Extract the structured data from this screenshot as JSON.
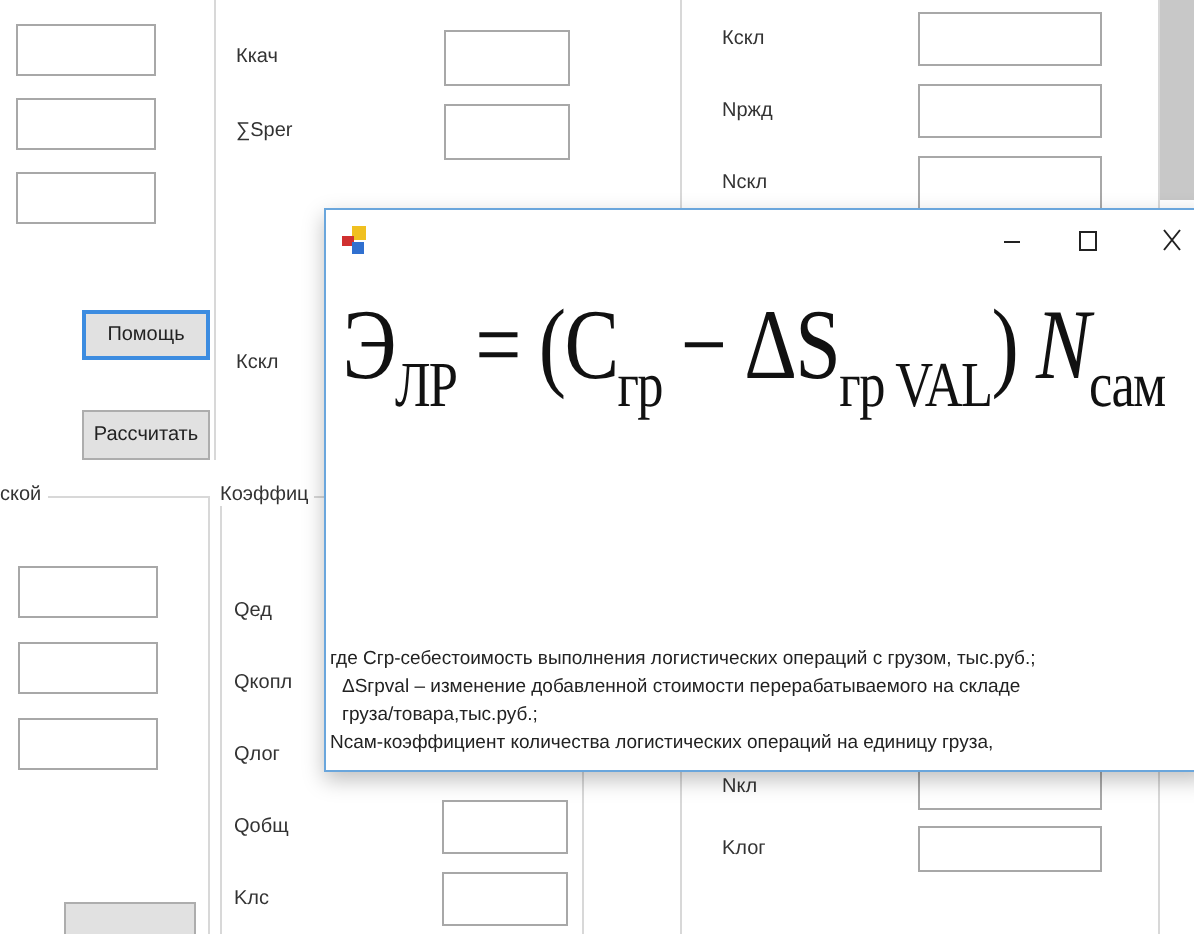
{
  "left_panel": {
    "buttons": [
      {
        "label": "Помощь",
        "selected": true
      },
      {
        "label": "Рассчитать",
        "selected": false
      }
    ]
  },
  "left_group": {
    "legend": "ской"
  },
  "middle_panel": {
    "rows": [
      {
        "label": "Ккач",
        "kind": "field"
      },
      {
        "label": "∑Sper",
        "kind": "field"
      },
      {
        "label": "Кскл",
        "kind": "label"
      }
    ]
  },
  "middle_group": {
    "legend": "Коэффиц",
    "rows": [
      {
        "label": "Qед",
        "kind": "label"
      },
      {
        "label": "Qкопл",
        "kind": "label"
      },
      {
        "label": "Qлог",
        "kind": "label"
      },
      {
        "label": "Qобщ",
        "kind": "field"
      },
      {
        "label": "Kлс",
        "kind": "field"
      }
    ]
  },
  "right_panel": {
    "rows": [
      {
        "label": "Кскл",
        "kind": "field"
      },
      {
        "label": "Nржд",
        "kind": "field"
      },
      {
        "label": "Nскл",
        "kind": "field"
      }
    ]
  },
  "right_group": {
    "rows": [
      {
        "label": "Nкл",
        "kind": "field"
      },
      {
        "label": "Kлог",
        "kind": "field"
      }
    ]
  },
  "formula_window": {
    "formula": "Э$_{ЛР}$ = (С$_{гр}$ − ΔS$_{гр VAL}$) *N*$_{сам}$",
    "description": [
      "где Сгр-себестоимость выполнения логистических операций с грузом, тыс.руб.;",
      "ΔSгрval – изменение добавленной стоимости перерабатываемого на складе",
      "груза/товара,тыс.руб.;",
      "Nсам-коэффициент количества логистических операций на единицу груза,"
    ]
  }
}
